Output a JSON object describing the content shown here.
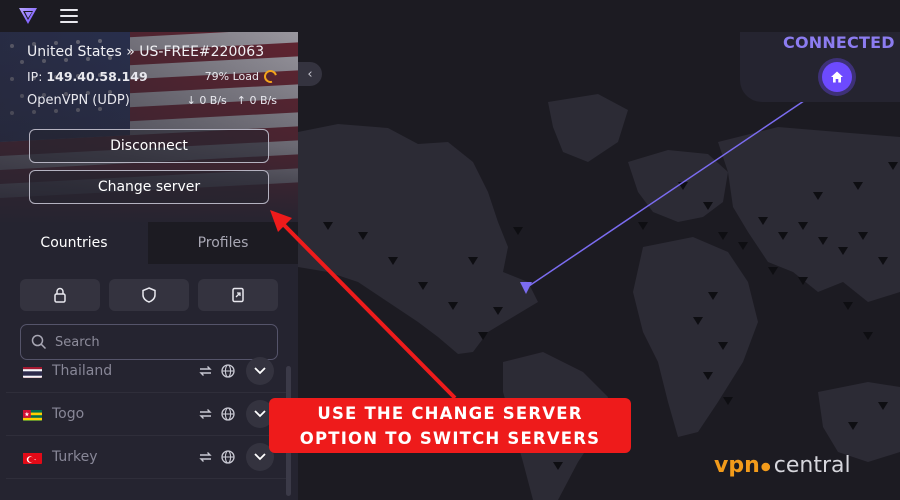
{
  "app": {
    "menu_icon": "hamburger-icon",
    "logo_icon": "protonvpn-logo-icon"
  },
  "connection": {
    "server": "United States » US-FREE#220063",
    "ip_label": "IP:",
    "ip_value": "149.40.58.149",
    "load": "79% Load",
    "protocol": "OpenVPN (UDP)",
    "download": "0 B/s",
    "upload": "0 B/s",
    "status": "CONNECTED",
    "accent": "#8c7cf0",
    "load_color": "#f3a41b"
  },
  "buttons": {
    "disconnect": "Disconnect",
    "change_server": "Change server"
  },
  "tabs": {
    "countries": "Countries",
    "profiles": "Profiles"
  },
  "filters": [
    "lock-icon",
    "shield-icon",
    "p2p-icon"
  ],
  "search": {
    "placeholder": "Search"
  },
  "countries": [
    {
      "name": "Thailand"
    },
    {
      "name": "Togo"
    },
    {
      "name": "Turkey"
    }
  ],
  "annotation": {
    "line1": "USE THE CHANGE SERVER",
    "line2": "OPTION TO SWITCH SERVERS",
    "color": "#ee1b1b"
  },
  "watermark": {
    "part1": "vpn",
    "part2": "central"
  }
}
